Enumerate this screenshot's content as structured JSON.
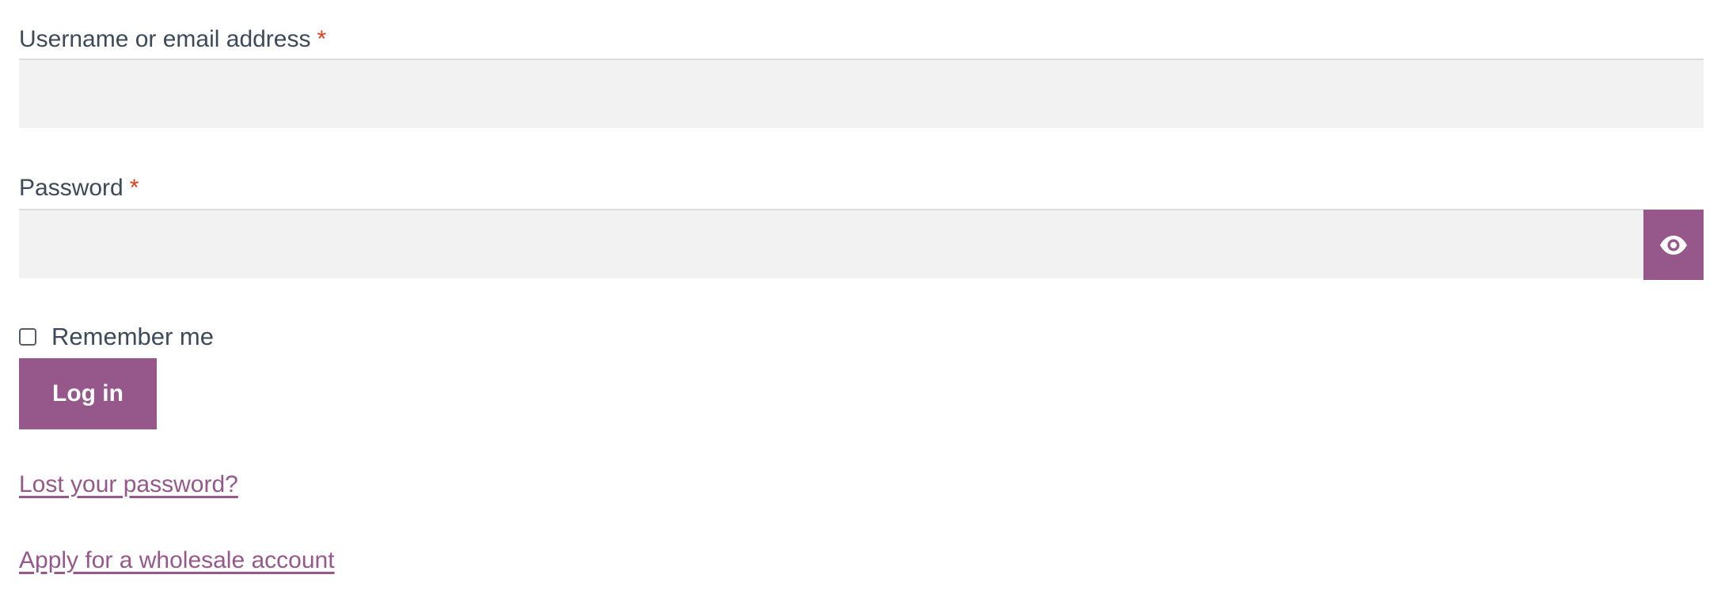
{
  "colors": {
    "accent": "#96588a",
    "required": "#e2401c",
    "text": "#3d4a5a",
    "input_bg": "#f2f2f2"
  },
  "username": {
    "label": "Username or email address",
    "required_mark": "*",
    "value": ""
  },
  "password": {
    "label": "Password",
    "required_mark": "*",
    "value": "",
    "toggle_icon": "eye-icon"
  },
  "remember": {
    "label": "Remember me",
    "checked": false
  },
  "actions": {
    "login_label": "Log in"
  },
  "links": {
    "lost_password": "Lost your password?",
    "wholesale": "Apply for a wholesale account"
  }
}
